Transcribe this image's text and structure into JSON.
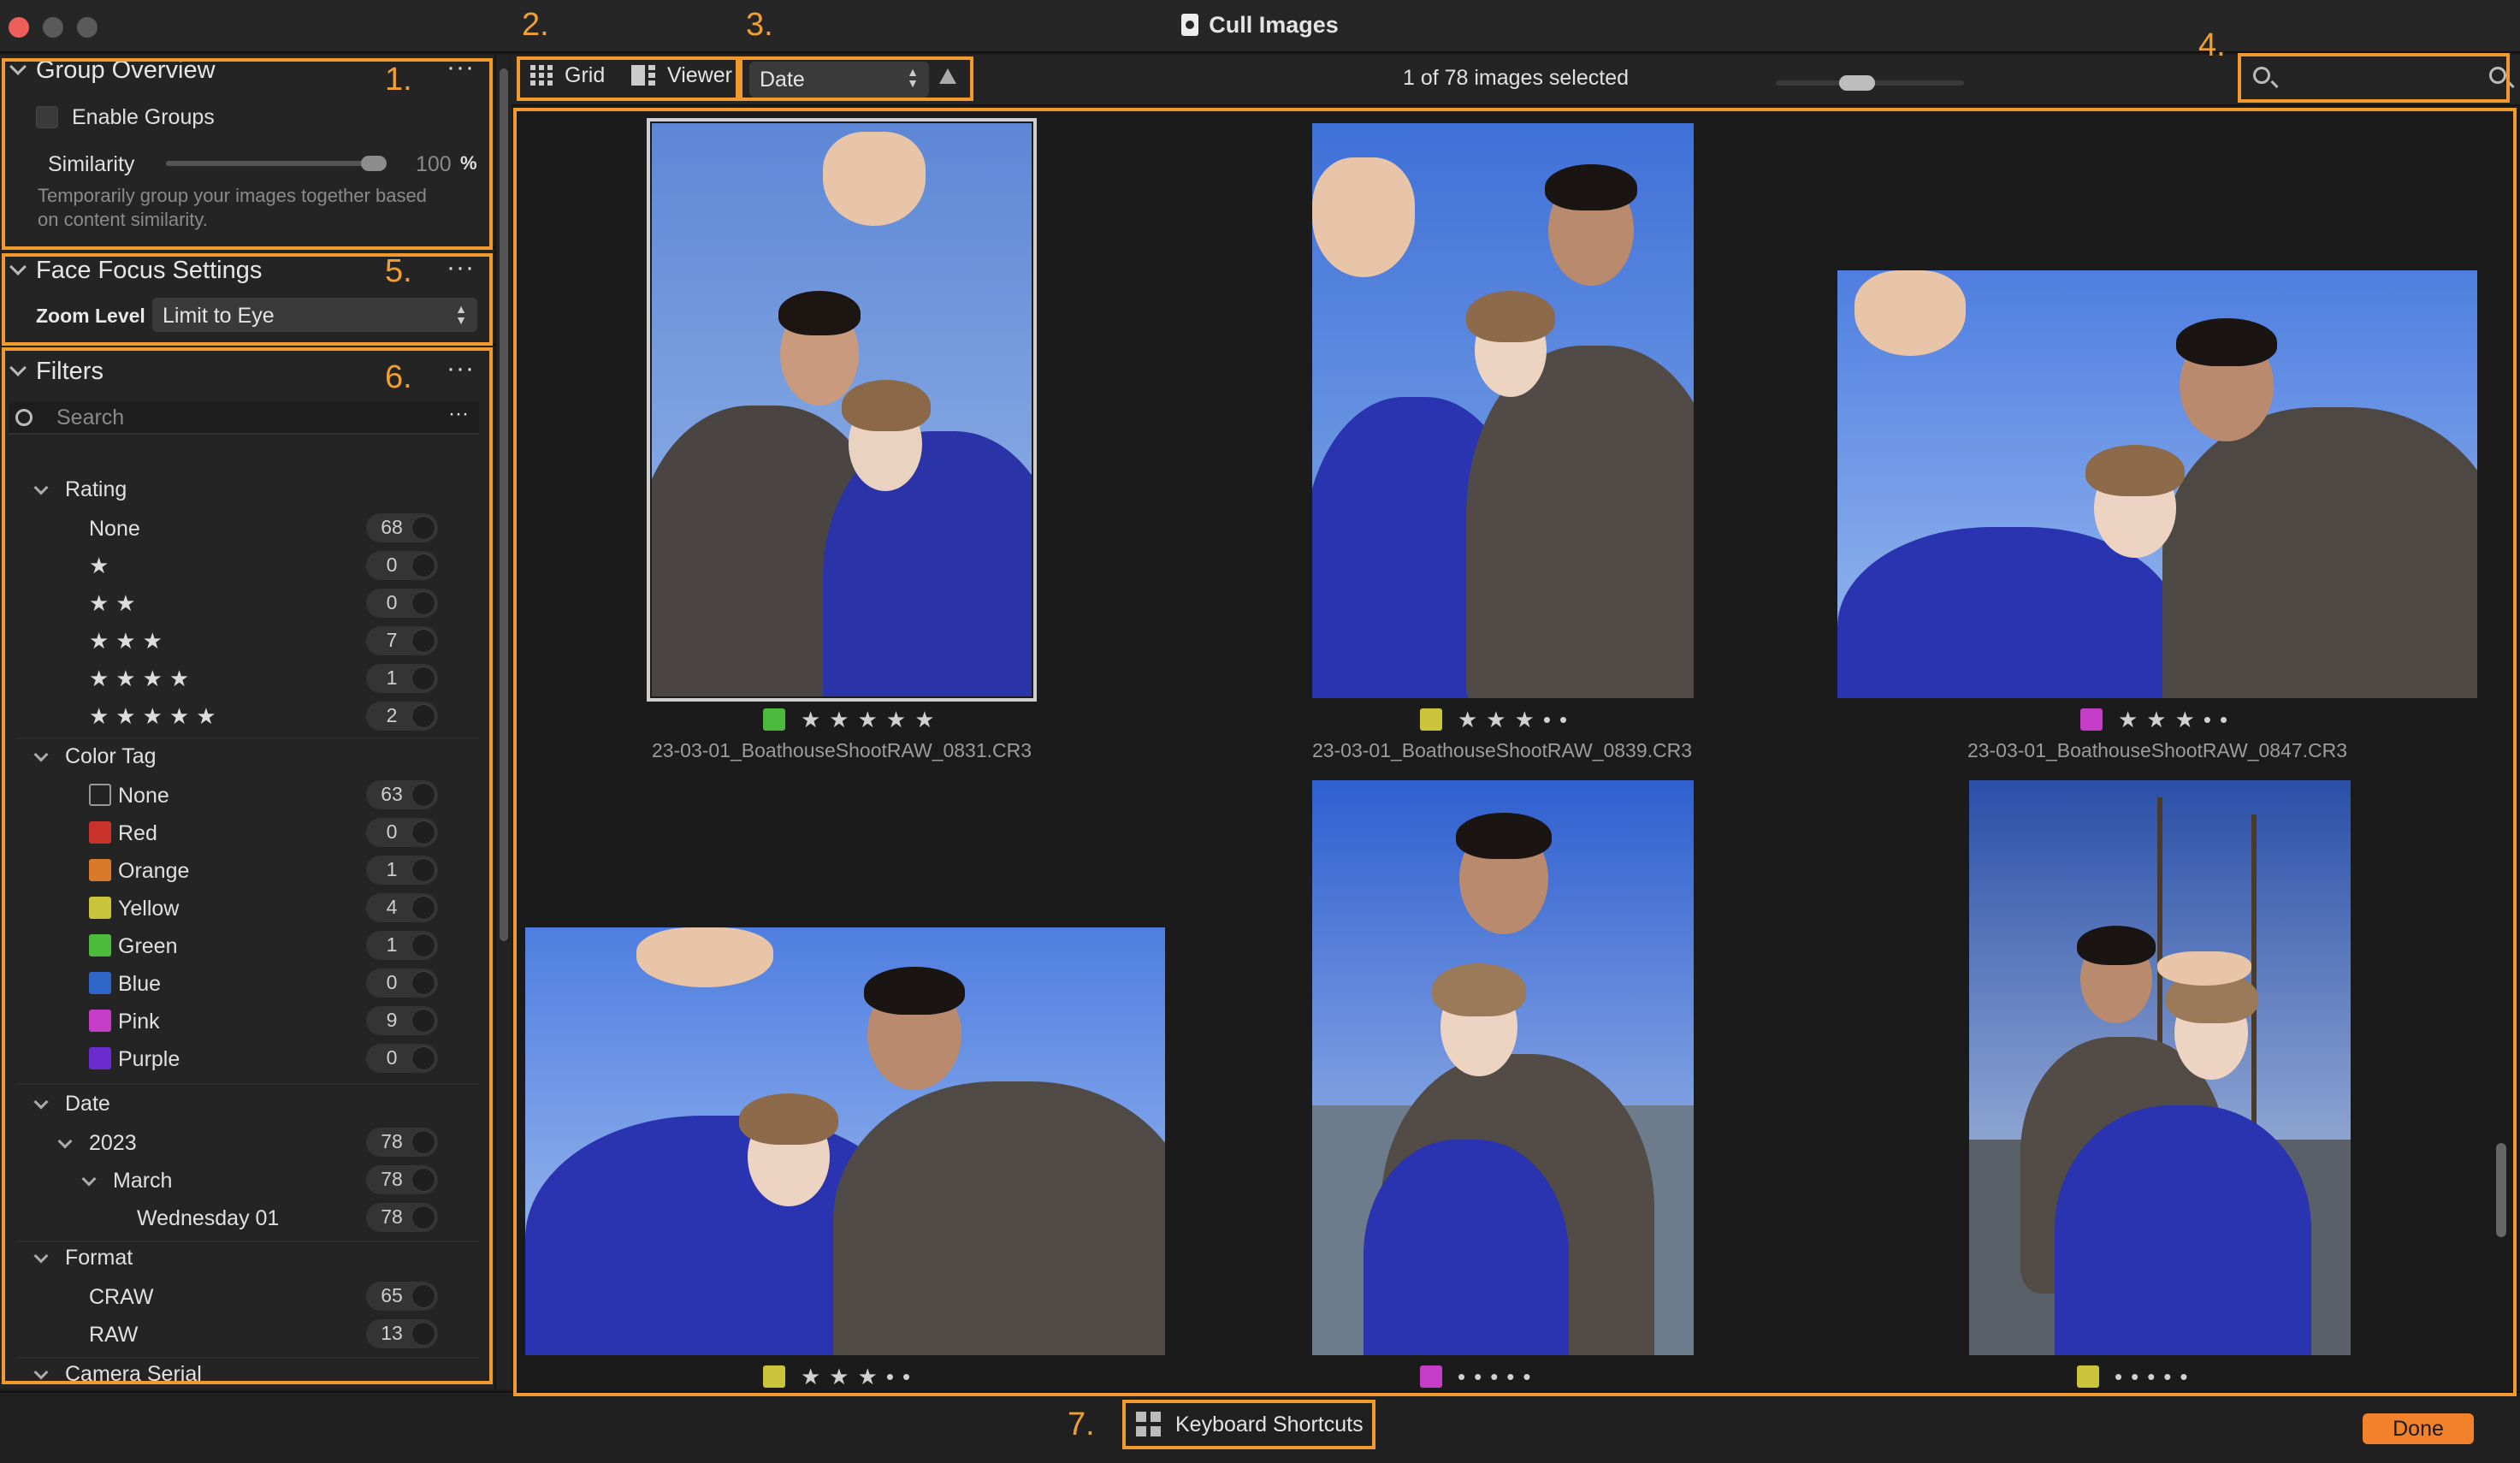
{
  "window": {
    "title": "Cull Images"
  },
  "callouts": [
    "1.",
    "2.",
    "3.",
    "4.",
    "5.",
    "6.",
    "7."
  ],
  "colors": {
    "accent": "#f29a2e",
    "done": "#f2812b"
  },
  "group_overview": {
    "title": "Group Overview",
    "more": "···",
    "enable_groups_label": "Enable Groups",
    "enable_groups_checked": false,
    "similarity_label": "Similarity",
    "similarity_value": "100",
    "similarity_unit": "%",
    "similarity_level": 1.0,
    "description_line1": "Temporarily group your images together based",
    "description_line2": "on content similarity."
  },
  "face_focus": {
    "title": "Face Focus Settings",
    "more": "···",
    "zoom_label": "Zoom Level",
    "zoom_value": "Limit to Eye"
  },
  "filters": {
    "title": "Filters",
    "more": "···",
    "search_placeholder": "Search",
    "search_more": "···",
    "rating": {
      "label": "Rating",
      "items": [
        {
          "label": "None",
          "stars": "",
          "count": "68"
        },
        {
          "label": "",
          "stars": "★",
          "count": "0"
        },
        {
          "label": "",
          "stars": "★★",
          "count": "0"
        },
        {
          "label": "",
          "stars": "★★★",
          "count": "7"
        },
        {
          "label": "",
          "stars": "★★★★",
          "count": "1"
        },
        {
          "label": "",
          "stars": "★★★★★",
          "count": "2"
        }
      ]
    },
    "color_tag": {
      "label": "Color Tag",
      "items": [
        {
          "label": "None",
          "color": "none",
          "count": "63"
        },
        {
          "label": "Red",
          "color": "#c8322b",
          "count": "0"
        },
        {
          "label": "Orange",
          "color": "#d97a2b",
          "count": "1"
        },
        {
          "label": "Yellow",
          "color": "#c9c43a",
          "count": "4"
        },
        {
          "label": "Green",
          "color": "#4cba3c",
          "count": "1"
        },
        {
          "label": "Blue",
          "color": "#2f64c9",
          "count": "0"
        },
        {
          "label": "Pink",
          "color": "#c43cc8",
          "count": "9"
        },
        {
          "label": "Purple",
          "color": "#6a2bd0",
          "count": "0"
        }
      ]
    },
    "date": {
      "label": "Date",
      "year": {
        "label": "2023",
        "count": "78"
      },
      "month": {
        "label": "March",
        "count": "78"
      },
      "day": {
        "label": "Wednesday 01",
        "count": "78"
      }
    },
    "format": {
      "label": "Format",
      "items": [
        {
          "label": "CRAW",
          "count": "65"
        },
        {
          "label": "RAW",
          "count": "13"
        }
      ]
    },
    "camera_serial": {
      "label": "Camera Serial"
    }
  },
  "toolbar": {
    "grid_label": "Grid",
    "viewer_label": "Viewer",
    "sort_value": "Date",
    "status": "1 of 78 images selected"
  },
  "images": [
    {
      "filename": "23-03-01_BoathouseShootRAW_0831.CR3",
      "tag_color": "#4cba3c",
      "stars": "★★★★★",
      "selected": true
    },
    {
      "filename": "23-03-01_BoathouseShootRAW_0839.CR3",
      "tag_color": "#c9c43a",
      "stars": "★★★••",
      "selected": false
    },
    {
      "filename": "23-03-01_BoathouseShootRAW_0847.CR3",
      "tag_color": "#c43cc8",
      "stars": "★★★••",
      "selected": false
    },
    {
      "filename": "",
      "tag_color": "#c9c43a",
      "stars": "★★★••",
      "selected": false
    },
    {
      "filename": "",
      "tag_color": "#c43cc8",
      "stars": "•••••",
      "selected": false
    },
    {
      "filename": "",
      "tag_color": "#c9c43a",
      "stars": "•••••",
      "selected": false
    }
  ],
  "bottom": {
    "keyboard_shortcuts_label": "Keyboard Shortcuts",
    "done_label": "Done"
  }
}
